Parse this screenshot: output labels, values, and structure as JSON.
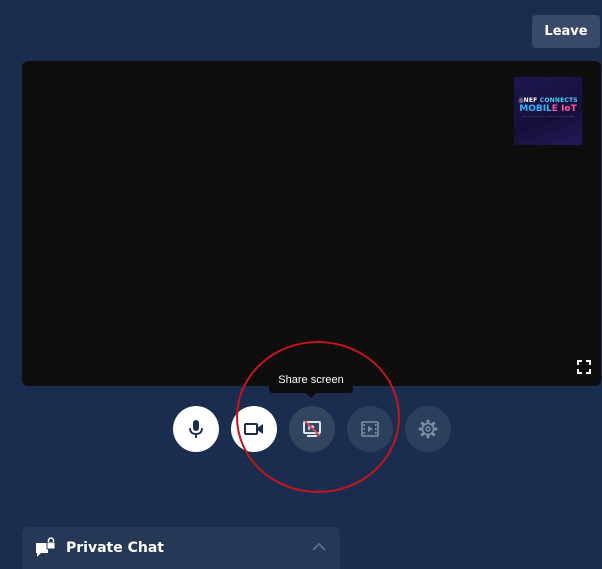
{
  "header": {
    "leave_label": "Leave"
  },
  "video": {
    "thumbnail": {
      "line1_a": "◎NEF",
      "line1_b": " CONNECTS",
      "line2_a": "MOBIL",
      "line2_b": "E IoT",
      "line3": "~~ ~~~ ~~~ ~~~ ~~~~~~~~"
    },
    "fullscreen_icon": "fullscreen-icon"
  },
  "tooltip": {
    "text": "Share screen"
  },
  "controls": [
    {
      "name": "mic-button",
      "icon": "microphone-icon"
    },
    {
      "name": "camera-button",
      "icon": "camera-icon"
    },
    {
      "name": "share-screen-button",
      "icon": "screen-share-off-icon"
    },
    {
      "name": "media-button",
      "icon": "video-frame-icon"
    },
    {
      "name": "settings-button",
      "icon": "gear-icon"
    }
  ],
  "chat": {
    "title": "Private Chat",
    "icon": "lock-chat-icon",
    "toggle_icon": "chevron-up-icon"
  },
  "colors": {
    "background": "#1a2d4e",
    "stage": "#0e0e0e",
    "annotation": "#c0161c"
  }
}
